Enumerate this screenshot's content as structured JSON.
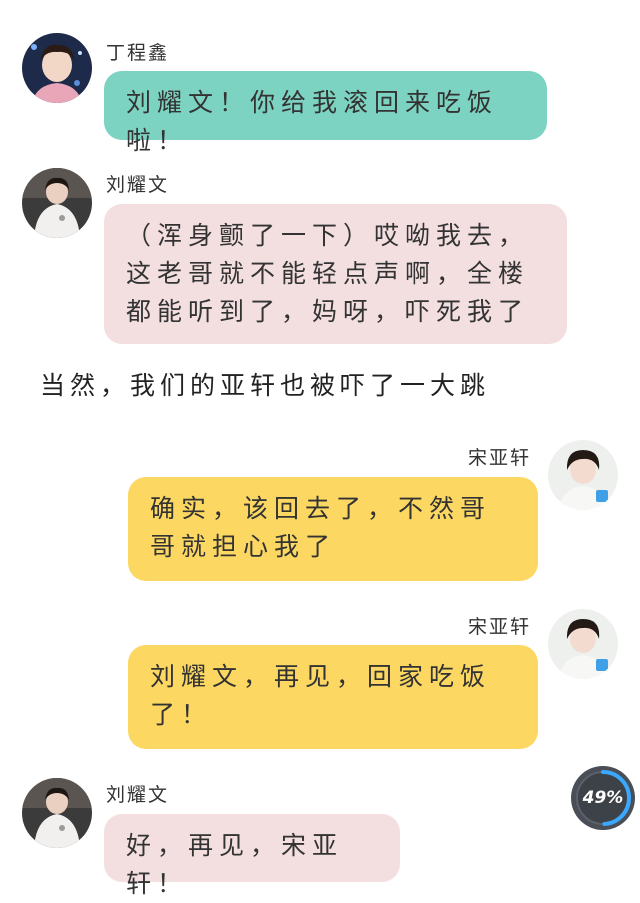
{
  "messages": [
    {
      "sender": "丁程鑫",
      "avatar": "avatar-dingchengxin",
      "side": "left",
      "color": "#7dd3c2",
      "text": "刘耀文！你给我滚回来吃饭啦！"
    },
    {
      "sender": "刘耀文",
      "avatar": "avatar-liuyaowen",
      "side": "left",
      "color": "#f3dfe0",
      "text": "（浑身颤了一下）哎呦我去，这老哥就不能轻点声啊，全楼都能听到了，妈呀，吓死我了"
    },
    {
      "sender": "宋亚轩",
      "avatar": "avatar-songyaxuan",
      "side": "right",
      "color": "#fcd862",
      "text": "确实，该回去了，不然哥哥就担心我了"
    },
    {
      "sender": "宋亚轩",
      "avatar": "avatar-songyaxuan",
      "side": "right",
      "color": "#fcd862",
      "text": "刘耀文，再见，回家吃饭了！"
    },
    {
      "sender": "刘耀文",
      "avatar": "avatar-liuyaowen",
      "side": "left",
      "color": "#f3dfe0",
      "text": "好，再见，宋亚轩！"
    }
  ],
  "narration": "当然，我们的亚轩也被吓了一大跳",
  "battery": {
    "label": "49%",
    "level": 0.49
  }
}
